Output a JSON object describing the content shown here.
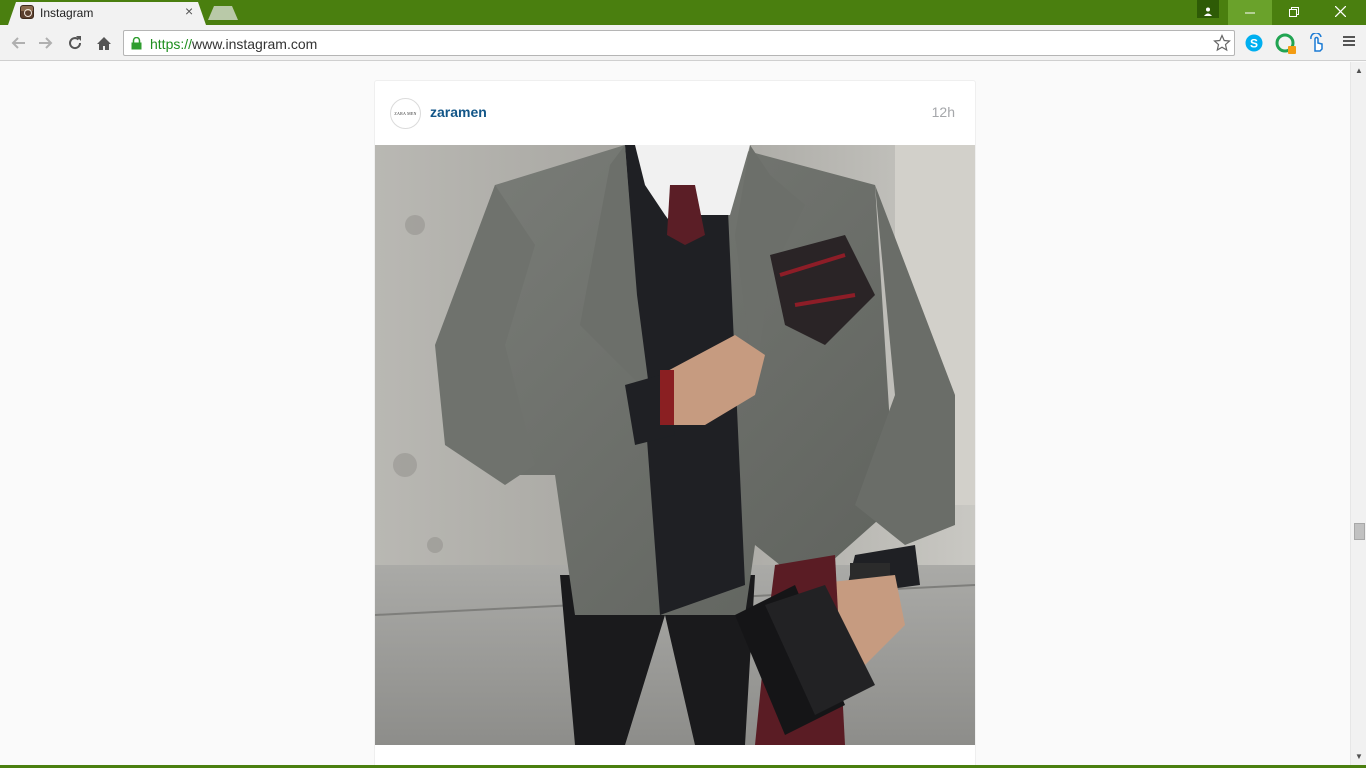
{
  "browser": {
    "tab_title": "Instagram",
    "tab_close": "×",
    "url_scheme": "https://",
    "url_rest": "www.instagram.com",
    "window_buttons": {
      "minimize": "—",
      "restore": "❐",
      "close": "✕"
    }
  },
  "post": {
    "avatar_text": "ZARA MEN",
    "username": "zaramen",
    "time": "12h"
  },
  "colors": {
    "titlebar": "#4a7f0f",
    "username": "#125688",
    "timestamp": "#a5a7aa"
  },
  "icons": [
    "back-icon",
    "forward-icon",
    "reload-icon",
    "home-icon",
    "lock-icon",
    "star-icon",
    "skype-icon",
    "extension-g-icon",
    "extension-hand-icon",
    "menu-icon"
  ]
}
